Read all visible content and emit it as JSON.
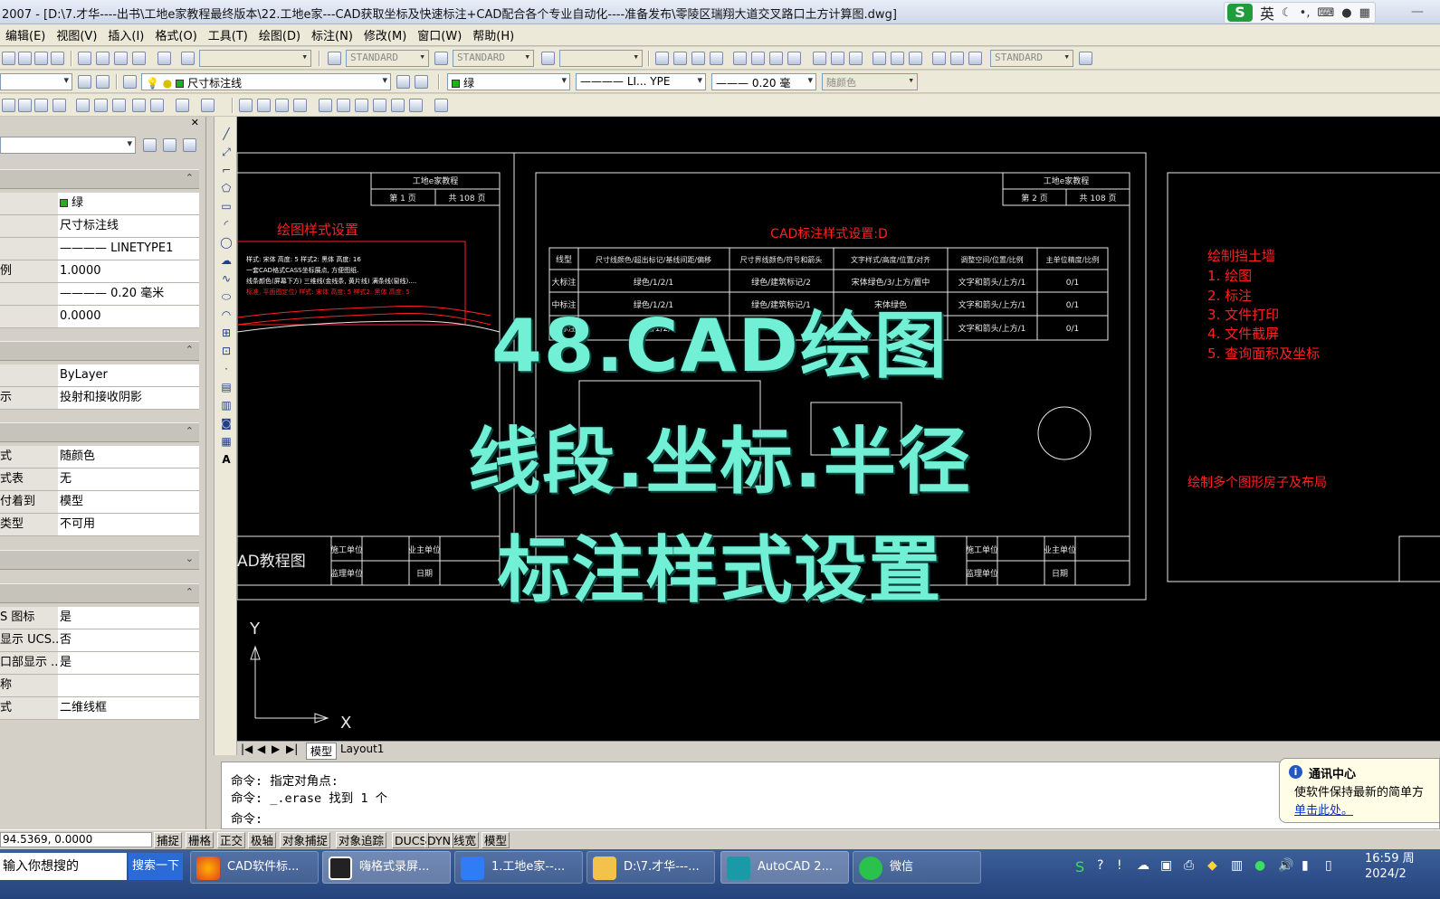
{
  "window": {
    "title": "2007 - [D:\\7.才华----出书\\工地e家教程最终版本\\22.工地e家---CAD获取坐标及快速标注+CAD配合各个专业自动化----准备发布\\零陵区瑞翔大道交叉路口土方计算图.dwg]",
    "ime_label": "英"
  },
  "menu": [
    "编辑(E)",
    "视图(V)",
    "插入(I)",
    "格式(O)",
    "工具(T)",
    "绘图(D)",
    "标注(N)",
    "修改(M)",
    "窗口(W)",
    "帮助(H)"
  ],
  "toolbars": {
    "text_style": "STANDARD",
    "dim_style": "STANDARD",
    "table_style": "STANDARD",
    "layer": "尺寸标注线",
    "color": "绿",
    "linetype": "LI... YPE",
    "lineweight": "0.20 毫",
    "plot_style": "随颜色"
  },
  "properties": {
    "general": [
      {
        "key": "",
        "value": "绿"
      },
      {
        "key": "",
        "value": "尺寸标注线"
      },
      {
        "key": "",
        "value": "———— LINETYPE1"
      },
      {
        "key": "例",
        "value": "1.0000"
      },
      {
        "key": "",
        "value": "———— 0.20 毫米"
      },
      {
        "key": "",
        "value": "0.0000"
      }
    ],
    "three_d": [
      {
        "key": "",
        "value": "ByLayer"
      },
      {
        "key": "示",
        "value": "投射和接收阴影"
      }
    ],
    "plot": [
      {
        "key": "式",
        "value": "随颜色"
      },
      {
        "key": "式表",
        "value": "无"
      },
      {
        "key": "付着到",
        "value": "模型"
      },
      {
        "key": "类型",
        "value": "不可用"
      }
    ],
    "misc": [
      {
        "key": "S 图标",
        "value": "是"
      },
      {
        "key": "显示 UCS...",
        "value": "否"
      },
      {
        "key": "口部显示 ...",
        "value": "是"
      },
      {
        "key": "称",
        "value": ""
      },
      {
        "key": "式",
        "value": "二维线框"
      }
    ]
  },
  "drawing": {
    "sheet_header_company": "工地e家教程",
    "sheet1_page": "第 1 页",
    "sheet1_total": "共 108 页",
    "sheet2_page": "第 2 页",
    "sheet2_total": "共 108 页",
    "sheet1_title": "绘图样式设置",
    "sheet1_notes": [
      "样式: 宋体  高度: 5  样式2: 黑体  高度: 16",
      "一套CAD格式CASS坐标展点, 方便图纸.",
      "线条颜色(屏幕下方)  三维线(金线条, 黄片线)  满条线(窗线)....",
      "标准, 平面图定位)  样式: 宋体  高度: 5  样式2: 黑体  高度: 5"
    ],
    "sheet1_footer": "AD教程图",
    "footer_cells": [
      "施工单位",
      "业主单位",
      "监理单位",
      "日期"
    ],
    "sheet2_title": "CAD标注样式设置:D",
    "table_headers": [
      "线型",
      "尺寸线颜色/超出标记/基线间距/偏移",
      "尺寸界线颜色/符号和箭头",
      "文字样式/高度/位置/对齐",
      "调整空间/位置/比例",
      "主单位精度/比例"
    ],
    "table_rows": [
      [
        "大标注",
        "绿色/1/2/1",
        "绿色/建筑标记/2",
        "宋体绿色/3/上方/置中",
        "文字和箭头/上方/1",
        "0/1"
      ],
      [
        "中标注",
        "绿色/1/2/1",
        "绿色/建筑标记/1",
        "宋体绿色",
        "文字和箭头/上方/1",
        "0/1"
      ],
      [
        "小标注",
        "绿色/1/2/",
        "绿色",
        "",
        "文字和箭头/上方/1",
        "0/1"
      ]
    ],
    "sheet3_list": [
      "绘制挡土墙",
      "1. 绘图",
      "2. 标注",
      "3. 文件打印",
      "4. 文件截屏",
      "5. 查询面积及坐标"
    ],
    "sheet3_note": "绘制多个图形房子及布局",
    "ucs_x": "X",
    "ucs_y": "Y",
    "red": "#ff2020",
    "line": "#e8e8e8"
  },
  "tabs": [
    "模型",
    "Layout1"
  ],
  "command": {
    "line1": "命令: 指定对角点:",
    "line2": "命令: _.erase 找到 1 个",
    "prompt": "命令:"
  },
  "status": {
    "coords": "94.5369, 0.0000",
    "toggles": [
      "捕捉",
      "栅格",
      "正交",
      "极轴",
      "对象捕捉",
      "对象追踪",
      "DUCS",
      "DYN",
      "线宽",
      "模型"
    ]
  },
  "notification": {
    "title": "通讯中心",
    "body": "使软件保持最新的简单方",
    "link": "单击此处。"
  },
  "taskbar": {
    "search_placeholder": "输入你想搜的",
    "search_button": "搜索一下",
    "tasks": [
      "CAD软件标...",
      "嗨格式录屏...",
      "1.工地e家--...",
      "D:\\7.才华---...",
      "AutoCAD 2...",
      "微信"
    ],
    "clock_time": "16:59 周",
    "clock_date": "2024/2"
  },
  "overlay": {
    "line1": "48.CAD绘图",
    "line2": "线段.坐标.半径",
    "line3": "标注样式设置"
  }
}
